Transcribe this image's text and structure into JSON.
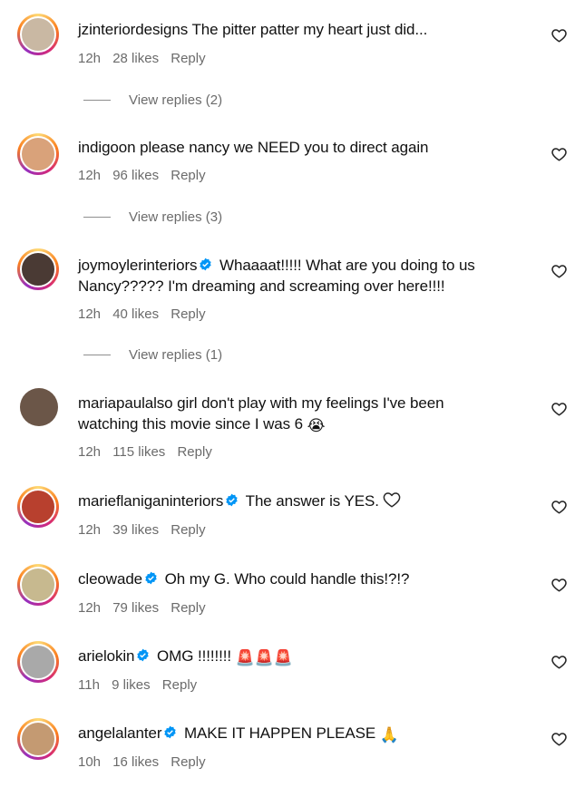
{
  "comments": [
    {
      "username": "jzinteriordesigns",
      "verified": false,
      "text": "The pitter patter my heart just did...",
      "time": "12h",
      "likes": "28 likes",
      "reply": "Reply",
      "view_replies": "View replies (2)",
      "avatar_color": "#c9b8a3"
    },
    {
      "username": "indigoon",
      "verified": false,
      "text": "please nancy we NEED you to direct again",
      "time": "12h",
      "likes": "96 likes",
      "reply": "Reply",
      "view_replies": "View replies (3)",
      "avatar_color": "#d9a27a"
    },
    {
      "username": "joymoylerinteriors",
      "verified": true,
      "text_line1": "Whaaaat!!!!! What are you doing to us",
      "text_line2": "Nancy????? I'm dreaming and screaming over here!!!!",
      "time": "12h",
      "likes": "40 likes",
      "reply": "Reply",
      "view_replies": "View replies (1)",
      "avatar_color": "#4a3a34"
    },
    {
      "username": "mariapaulalso",
      "verified": false,
      "text_line1": "girl don't play with my feelings I've been",
      "text_line2": "watching this movie since I was 6",
      "emoji": "😭",
      "time": "12h",
      "likes": "115 likes",
      "reply": "Reply",
      "avatar_color": "#6b5648"
    },
    {
      "username": "marieflaniganinteriors",
      "verified": true,
      "text": "The answer is YES.",
      "time": "12h",
      "likes": "39 likes",
      "reply": "Reply",
      "avatar_color": "#b8402e"
    },
    {
      "username": "cleowade",
      "verified": true,
      "text": "Oh my G. Who could handle this!?!?",
      "time": "12h",
      "likes": "79 likes",
      "reply": "Reply",
      "avatar_color": "#c7b98f"
    },
    {
      "username": "arielokin",
      "verified": true,
      "text": "OMG !!!!!!!!",
      "emoji": "🚨🚨🚨",
      "time": "11h",
      "likes": "9 likes",
      "reply": "Reply",
      "avatar_color": "#a9a9a9"
    },
    {
      "username": "angelalanter",
      "verified": true,
      "text": "MAKE IT HAPPEN PLEASE",
      "emoji": "🙏",
      "time": "10h",
      "likes": "16 likes",
      "reply": "Reply",
      "avatar_color": "#c49a72"
    }
  ],
  "colors": {
    "verified_badge": "#0095f6",
    "meta_text": "#6b6b6b",
    "heart_outline": "#262626"
  },
  "icons": {
    "like": "heart-outline-icon",
    "verified": "verified-badge-icon"
  }
}
